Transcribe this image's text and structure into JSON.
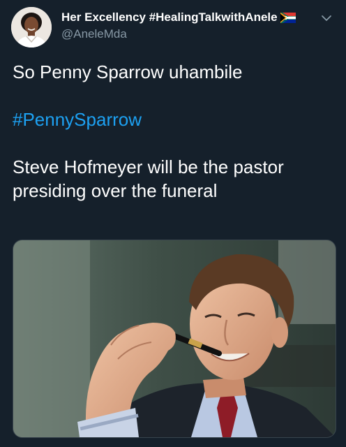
{
  "tweet": {
    "author": {
      "display_name": "Her Excellency #HealingTalkwithAnele",
      "handle": "@AneleMda",
      "flag_icon": "south-africa-flag-icon",
      "avatar_icon": "user-avatar"
    },
    "menu_icon": "chevron-down-icon",
    "text": {
      "line1": "So Penny Sparrow uhambile",
      "hashtag": "#PennySparrow",
      "line3": "Steve Hofmeyer will be the pastor presiding over the funeral"
    },
    "media": {
      "kind": "photo",
      "icon": "man-with-pen-photo"
    },
    "colors": {
      "background": "#15202b",
      "text": "#ffffff",
      "secondary": "#8899a6",
      "link": "#1da1f2"
    }
  }
}
